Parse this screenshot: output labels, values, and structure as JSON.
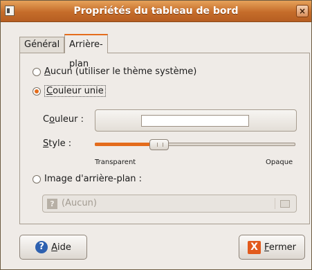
{
  "window": {
    "title": "Propriétés du tableau de bord",
    "close_glyph": "×"
  },
  "tabs": [
    {
      "label": "Général",
      "active": false
    },
    {
      "label": "Arrière-plan",
      "active": true
    }
  ],
  "background": {
    "option_none": {
      "accel": "A",
      "rest": "ucun (utiliser le thème système)",
      "checked": false
    },
    "option_solid": {
      "accel": "C",
      "rest": "ouleur unie",
      "checked": true
    },
    "color_label": {
      "pre": "C",
      "accel": "o",
      "rest": "uleur :"
    },
    "color_value": "#ffffff",
    "style_label": {
      "accel": "S",
      "rest": "tyle :"
    },
    "style_level_percent": 30,
    "slider_min_label": "Transparent",
    "slider_max_label": "Opaque",
    "option_image": {
      "label": "Image d'arrière-plan :",
      "checked": false
    },
    "file_chooser_value": "(Aucun)",
    "file_icon_glyph": "?"
  },
  "buttons": {
    "help": {
      "accel": "A",
      "rest": "ide",
      "icon_glyph": "?"
    },
    "close": {
      "accel": "F",
      "rest": "ermer",
      "icon_glyph": "X"
    }
  },
  "colors": {
    "accent": "#e46c1c",
    "titlebar": "#c56c2a"
  }
}
